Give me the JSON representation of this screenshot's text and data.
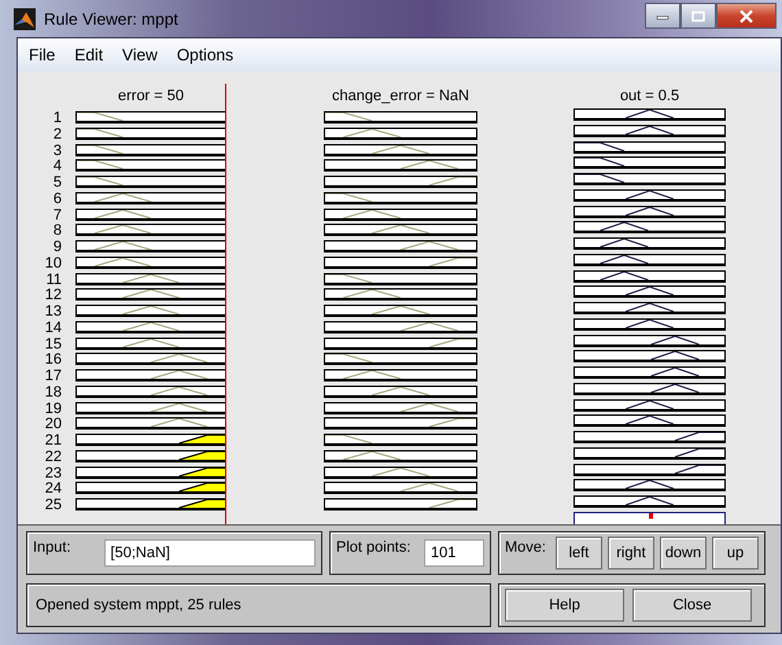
{
  "window": {
    "title": "Rule Viewer: mppt"
  },
  "menu": [
    "File",
    "Edit",
    "View",
    "Options"
  ],
  "variables": [
    {
      "label": "error = 50",
      "kind": "input",
      "level": 1
    },
    {
      "label": "change_error = NaN",
      "kind": "input"
    },
    {
      "label": "out = 0.5",
      "kind": "output",
      "level": 0.5
    }
  ],
  "rules": [
    {
      "number": "1",
      "plots": [
        {
          "kind": "left",
          "fired": false
        },
        {
          "kind": "left",
          "fired": false
        },
        {
          "kind": "center",
          "fired": false
        }
      ]
    },
    {
      "number": "2",
      "plots": [
        {
          "kind": "left",
          "fired": false
        },
        {
          "kind": "leftish",
          "fired": false
        },
        {
          "kind": "center",
          "fired": false
        }
      ]
    },
    {
      "number": "3",
      "plots": [
        {
          "kind": "left",
          "fired": false
        },
        {
          "kind": "center",
          "fired": false
        },
        {
          "kind": "left",
          "fired": false
        }
      ]
    },
    {
      "number": "4",
      "plots": [
        {
          "kind": "left",
          "fired": false
        },
        {
          "kind": "rightish",
          "fired": false
        },
        {
          "kind": "left",
          "fired": false
        }
      ]
    },
    {
      "number": "5",
      "plots": [
        {
          "kind": "left",
          "fired": false
        },
        {
          "kind": "right",
          "fired": false
        },
        {
          "kind": "left",
          "fired": false
        }
      ]
    },
    {
      "number": "6",
      "plots": [
        {
          "kind": "leftish",
          "fired": false
        },
        {
          "kind": "left",
          "fired": false
        },
        {
          "kind": "center",
          "fired": false
        }
      ]
    },
    {
      "number": "7",
      "plots": [
        {
          "kind": "leftish",
          "fired": false
        },
        {
          "kind": "leftish",
          "fired": false
        },
        {
          "kind": "center",
          "fired": false
        }
      ]
    },
    {
      "number": "8",
      "plots": [
        {
          "kind": "leftish",
          "fired": false
        },
        {
          "kind": "center",
          "fired": false
        },
        {
          "kind": "leftish",
          "fired": false
        }
      ]
    },
    {
      "number": "9",
      "plots": [
        {
          "kind": "leftish",
          "fired": false
        },
        {
          "kind": "rightish",
          "fired": false
        },
        {
          "kind": "leftish",
          "fired": false
        }
      ]
    },
    {
      "number": "10",
      "plots": [
        {
          "kind": "leftish",
          "fired": false
        },
        {
          "kind": "right",
          "fired": false
        },
        {
          "kind": "leftish",
          "fired": false
        }
      ]
    },
    {
      "number": "11",
      "plots": [
        {
          "kind": "center",
          "fired": false
        },
        {
          "kind": "left",
          "fired": false
        },
        {
          "kind": "leftish",
          "fired": false
        }
      ]
    },
    {
      "number": "12",
      "plots": [
        {
          "kind": "center",
          "fired": false
        },
        {
          "kind": "leftish",
          "fired": false
        },
        {
          "kind": "center",
          "fired": false
        }
      ]
    },
    {
      "number": "13",
      "plots": [
        {
          "kind": "center",
          "fired": false
        },
        {
          "kind": "center",
          "fired": false
        },
        {
          "kind": "center",
          "fired": false
        }
      ]
    },
    {
      "number": "14",
      "plots": [
        {
          "kind": "center",
          "fired": false
        },
        {
          "kind": "rightish",
          "fired": false
        },
        {
          "kind": "center",
          "fired": false
        }
      ]
    },
    {
      "number": "15",
      "plots": [
        {
          "kind": "center",
          "fired": false
        },
        {
          "kind": "right",
          "fired": false
        },
        {
          "kind": "rightish",
          "fired": false
        }
      ]
    },
    {
      "number": "16",
      "plots": [
        {
          "kind": "rightish",
          "fired": false
        },
        {
          "kind": "left",
          "fired": false
        },
        {
          "kind": "rightish",
          "fired": false
        }
      ]
    },
    {
      "number": "17",
      "plots": [
        {
          "kind": "rightish",
          "fired": false
        },
        {
          "kind": "leftish",
          "fired": false
        },
        {
          "kind": "rightish",
          "fired": false
        }
      ]
    },
    {
      "number": "18",
      "plots": [
        {
          "kind": "rightish",
          "fired": false
        },
        {
          "kind": "center",
          "fired": false
        },
        {
          "kind": "rightish",
          "fired": false
        }
      ]
    },
    {
      "number": "19",
      "plots": [
        {
          "kind": "rightish",
          "fired": false
        },
        {
          "kind": "rightish",
          "fired": false
        },
        {
          "kind": "center",
          "fired": false
        }
      ]
    },
    {
      "number": "20",
      "plots": [
        {
          "kind": "rightish",
          "fired": false
        },
        {
          "kind": "right",
          "fired": false
        },
        {
          "kind": "center",
          "fired": false
        }
      ]
    },
    {
      "number": "21",
      "plots": [
        {
          "kind": "right",
          "fired": true
        },
        {
          "kind": "left",
          "fired": false
        },
        {
          "kind": "right",
          "fired": false
        }
      ]
    },
    {
      "number": "22",
      "plots": [
        {
          "kind": "right",
          "fired": true
        },
        {
          "kind": "leftish",
          "fired": false
        },
        {
          "kind": "right",
          "fired": false
        }
      ]
    },
    {
      "number": "23",
      "plots": [
        {
          "kind": "right",
          "fired": true
        },
        {
          "kind": "center",
          "fired": false
        },
        {
          "kind": "right",
          "fired": false
        }
      ]
    },
    {
      "number": "24",
      "plots": [
        {
          "kind": "right",
          "fired": true
        },
        {
          "kind": "rightish",
          "fired": false
        },
        {
          "kind": "center",
          "fired": false
        }
      ]
    },
    {
      "number": "25",
      "plots": [
        {
          "kind": "right",
          "fired": true
        },
        {
          "kind": "right",
          "fired": false
        },
        {
          "kind": "center",
          "fired": false
        }
      ]
    }
  ],
  "input": {
    "label": "Input:",
    "value": "[50;NaN]"
  },
  "plot_points": {
    "label": "Plot points:",
    "value": "101"
  },
  "move": {
    "label": "Move:",
    "buttons": [
      "left",
      "right",
      "down",
      "up"
    ]
  },
  "status": "Opened system mppt, 25 rules",
  "buttons": [
    "Help",
    "Close"
  ]
}
